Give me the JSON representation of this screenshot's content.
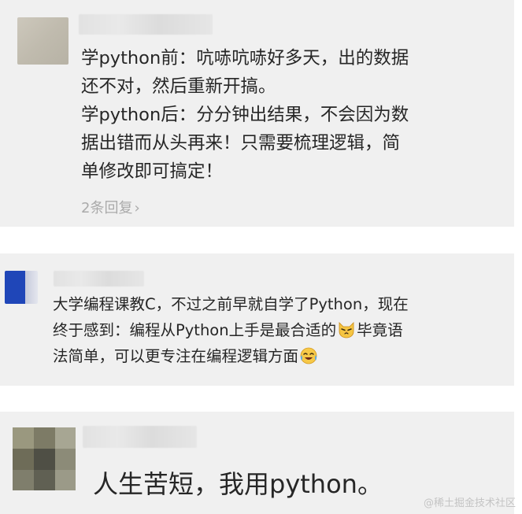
{
  "comments": [
    {
      "lines": [
        "学python前：吭哧吭哧好多天，出的数据",
        "还不对，然后重新开搞。",
        "学python后：分分钟出结果，不会因为数",
        "据出错而从头再来！只需要梳理逻辑，简",
        "单修改即可搞定！"
      ],
      "reply_label": "2条回复"
    },
    {
      "line1": "大学编程课教C，不过之前早就自学了Python，现在",
      "line2_before": "终于感到：编程从Python上手是最合适的",
      "line2_after": "毕竟语",
      "line3": "法简单，可以更专注在编程逻辑方面",
      "emoji_1": "cat-face-emoji",
      "emoji_2": "crying-laughing-emoji"
    },
    {
      "text": "人生苦短，我用python。"
    }
  ],
  "watermark": "@稀土掘金技术社区",
  "colors": {
    "card_bg": "#f0f0f0",
    "text": "#262626",
    "muted": "#aaaaaa",
    "avatar_blue": "#1f46b8"
  }
}
